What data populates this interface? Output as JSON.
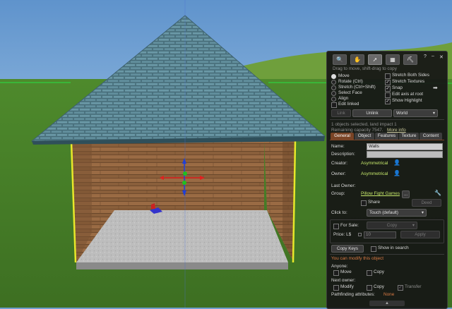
{
  "toolbar": {
    "tools": [
      {
        "icon": "magnifier-icon",
        "glyph": "🔍"
      },
      {
        "icon": "hand-icon",
        "glyph": "✋"
      },
      {
        "icon": "arrow-move-icon",
        "glyph": "➚"
      },
      {
        "icon": "cube-create-icon",
        "glyph": "▦"
      },
      {
        "icon": "bulldozer-icon",
        "glyph": "⛏"
      }
    ],
    "help": "?",
    "minimize": "–",
    "close": "✕",
    "hint": "Drag to move, shift-drag to copy"
  },
  "modes": [
    {
      "label": "Move",
      "selected": true
    },
    {
      "label": "Rotate (Ctrl)",
      "selected": false
    },
    {
      "label": "Stretch (Ctrl+Shift)",
      "selected": false
    },
    {
      "label": "Select Face",
      "selected": false
    },
    {
      "label": "Align",
      "selected": false
    }
  ],
  "edit_linked": {
    "label": "Edit linked",
    "checked": false
  },
  "options": [
    {
      "label": "Stretch Both Sides",
      "checked": false
    },
    {
      "label": "Stretch Textures",
      "checked": true
    },
    {
      "label": "Snap",
      "checked": true
    },
    {
      "label": "Edit axis at root",
      "checked": false
    },
    {
      "label": "Show Highlight",
      "checked": true
    }
  ],
  "link_row": {
    "link": "Link",
    "unlink": "Unlink",
    "ruler": "World"
  },
  "status": {
    "selected": "1 objects selected, land impact 1",
    "remaining": "Remaining capacity 7547.",
    "more_info": "More info"
  },
  "tabs": [
    "General",
    "Object",
    "Features",
    "Texture",
    "Content"
  ],
  "general": {
    "name_label": "Name:",
    "name_value": "Walls",
    "description_label": "Description:",
    "description_value": "",
    "creator_label": "Creator:",
    "creator_value": "Asymmetrical",
    "owner_label": "Owner:",
    "owner_value": "Asymmetrical",
    "last_owner_label": "Last Owner:",
    "group_label": "Group:",
    "group_value": "Pillow Fight Games",
    "group_btn": "...",
    "share_label": "Share",
    "deed_label": "Deed",
    "click_label": "Click to:",
    "click_value": "Touch  (default)",
    "for_sale_label": "For Sale:",
    "sale_type": "Copy",
    "price_label": "Price: L$",
    "price_value": "10",
    "apply_label": "Apply",
    "copy_keys_label": "Copy Keys",
    "show_in_search_label": "Show in search",
    "modify_note": "You can modify this object",
    "anyone_label": "Anyone:",
    "anyone_move": "Move",
    "anyone_copy": "Copy",
    "next_owner_label": "Next owner:",
    "next_modify": "Modify",
    "next_copy": "Copy",
    "next_transfer": "Transfer",
    "pathfinding_label": "Pathfinding attributes:",
    "pathfinding_value": "None"
  },
  "colors": {
    "accent": "#d97a44",
    "tab_selected": "#7a4426",
    "panel_bg": "#161616",
    "link": "#c9c79a"
  }
}
